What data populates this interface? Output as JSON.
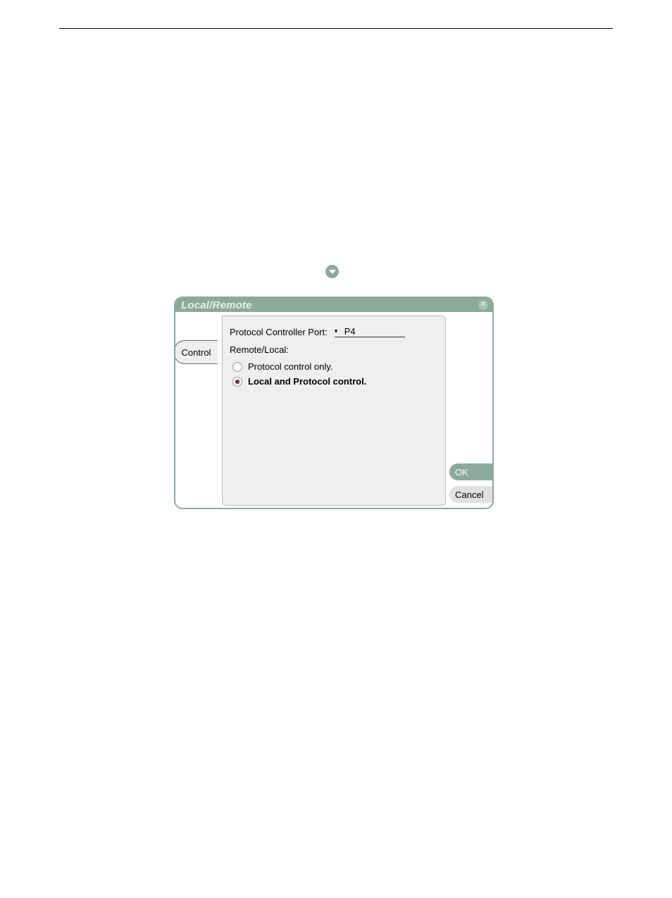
{
  "dialog": {
    "title": "Local/Remote",
    "close_glyph": "✕",
    "tab_label": "Control",
    "panel": {
      "port_label": "Protocol Controller Port:",
      "port_value": "P4",
      "section_label": "Remote/Local:",
      "options": [
        {
          "label": "Protocol control only.",
          "selected": false
        },
        {
          "label": "Local and Protocol control.",
          "selected": true
        }
      ]
    },
    "ok_label": "OK",
    "cancel_label": "Cancel"
  }
}
